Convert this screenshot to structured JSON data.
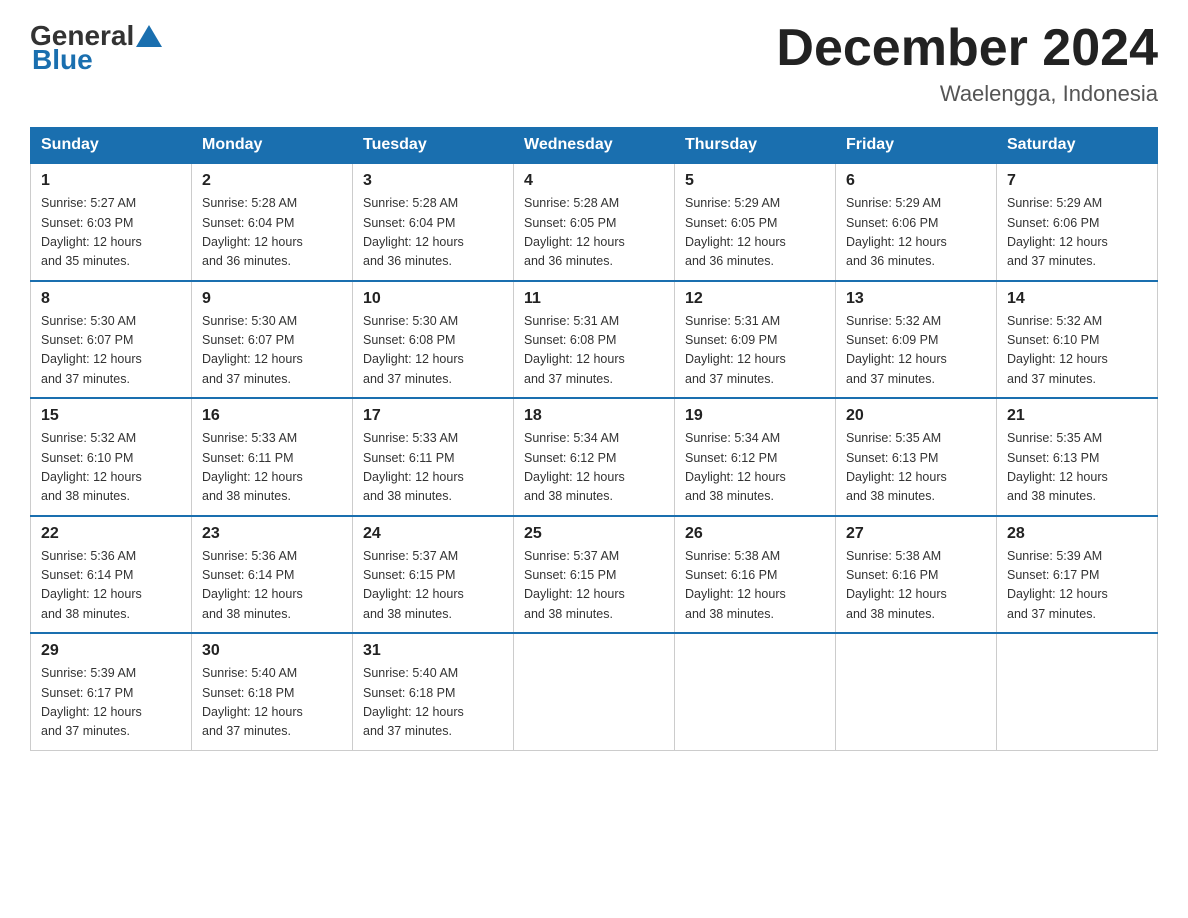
{
  "header": {
    "logo_general": "General",
    "logo_blue": "Blue",
    "month_title": "December 2024",
    "location": "Waelengga, Indonesia"
  },
  "days_of_week": [
    "Sunday",
    "Monday",
    "Tuesday",
    "Wednesday",
    "Thursday",
    "Friday",
    "Saturday"
  ],
  "weeks": [
    [
      {
        "day": "1",
        "sunrise": "5:27 AM",
        "sunset": "6:03 PM",
        "daylight": "12 hours and 35 minutes."
      },
      {
        "day": "2",
        "sunrise": "5:28 AM",
        "sunset": "6:04 PM",
        "daylight": "12 hours and 36 minutes."
      },
      {
        "day": "3",
        "sunrise": "5:28 AM",
        "sunset": "6:04 PM",
        "daylight": "12 hours and 36 minutes."
      },
      {
        "day": "4",
        "sunrise": "5:28 AM",
        "sunset": "6:05 PM",
        "daylight": "12 hours and 36 minutes."
      },
      {
        "day": "5",
        "sunrise": "5:29 AM",
        "sunset": "6:05 PM",
        "daylight": "12 hours and 36 minutes."
      },
      {
        "day": "6",
        "sunrise": "5:29 AM",
        "sunset": "6:06 PM",
        "daylight": "12 hours and 36 minutes."
      },
      {
        "day": "7",
        "sunrise": "5:29 AM",
        "sunset": "6:06 PM",
        "daylight": "12 hours and 37 minutes."
      }
    ],
    [
      {
        "day": "8",
        "sunrise": "5:30 AM",
        "sunset": "6:07 PM",
        "daylight": "12 hours and 37 minutes."
      },
      {
        "day": "9",
        "sunrise": "5:30 AM",
        "sunset": "6:07 PM",
        "daylight": "12 hours and 37 minutes."
      },
      {
        "day": "10",
        "sunrise": "5:30 AM",
        "sunset": "6:08 PM",
        "daylight": "12 hours and 37 minutes."
      },
      {
        "day": "11",
        "sunrise": "5:31 AM",
        "sunset": "6:08 PM",
        "daylight": "12 hours and 37 minutes."
      },
      {
        "day": "12",
        "sunrise": "5:31 AM",
        "sunset": "6:09 PM",
        "daylight": "12 hours and 37 minutes."
      },
      {
        "day": "13",
        "sunrise": "5:32 AM",
        "sunset": "6:09 PM",
        "daylight": "12 hours and 37 minutes."
      },
      {
        "day": "14",
        "sunrise": "5:32 AM",
        "sunset": "6:10 PM",
        "daylight": "12 hours and 37 minutes."
      }
    ],
    [
      {
        "day": "15",
        "sunrise": "5:32 AM",
        "sunset": "6:10 PM",
        "daylight": "12 hours and 38 minutes."
      },
      {
        "day": "16",
        "sunrise": "5:33 AM",
        "sunset": "6:11 PM",
        "daylight": "12 hours and 38 minutes."
      },
      {
        "day": "17",
        "sunrise": "5:33 AM",
        "sunset": "6:11 PM",
        "daylight": "12 hours and 38 minutes."
      },
      {
        "day": "18",
        "sunrise": "5:34 AM",
        "sunset": "6:12 PM",
        "daylight": "12 hours and 38 minutes."
      },
      {
        "day": "19",
        "sunrise": "5:34 AM",
        "sunset": "6:12 PM",
        "daylight": "12 hours and 38 minutes."
      },
      {
        "day": "20",
        "sunrise": "5:35 AM",
        "sunset": "6:13 PM",
        "daylight": "12 hours and 38 minutes."
      },
      {
        "day": "21",
        "sunrise": "5:35 AM",
        "sunset": "6:13 PM",
        "daylight": "12 hours and 38 minutes."
      }
    ],
    [
      {
        "day": "22",
        "sunrise": "5:36 AM",
        "sunset": "6:14 PM",
        "daylight": "12 hours and 38 minutes."
      },
      {
        "day": "23",
        "sunrise": "5:36 AM",
        "sunset": "6:14 PM",
        "daylight": "12 hours and 38 minutes."
      },
      {
        "day": "24",
        "sunrise": "5:37 AM",
        "sunset": "6:15 PM",
        "daylight": "12 hours and 38 minutes."
      },
      {
        "day": "25",
        "sunrise": "5:37 AM",
        "sunset": "6:15 PM",
        "daylight": "12 hours and 38 minutes."
      },
      {
        "day": "26",
        "sunrise": "5:38 AM",
        "sunset": "6:16 PM",
        "daylight": "12 hours and 38 minutes."
      },
      {
        "day": "27",
        "sunrise": "5:38 AM",
        "sunset": "6:16 PM",
        "daylight": "12 hours and 38 minutes."
      },
      {
        "day": "28",
        "sunrise": "5:39 AM",
        "sunset": "6:17 PM",
        "daylight": "12 hours and 37 minutes."
      }
    ],
    [
      {
        "day": "29",
        "sunrise": "5:39 AM",
        "sunset": "6:17 PM",
        "daylight": "12 hours and 37 minutes."
      },
      {
        "day": "30",
        "sunrise": "5:40 AM",
        "sunset": "6:18 PM",
        "daylight": "12 hours and 37 minutes."
      },
      {
        "day": "31",
        "sunrise": "5:40 AM",
        "sunset": "6:18 PM",
        "daylight": "12 hours and 37 minutes."
      },
      null,
      null,
      null,
      null
    ]
  ],
  "labels": {
    "sunrise": "Sunrise:",
    "sunset": "Sunset:",
    "daylight": "Daylight:"
  }
}
